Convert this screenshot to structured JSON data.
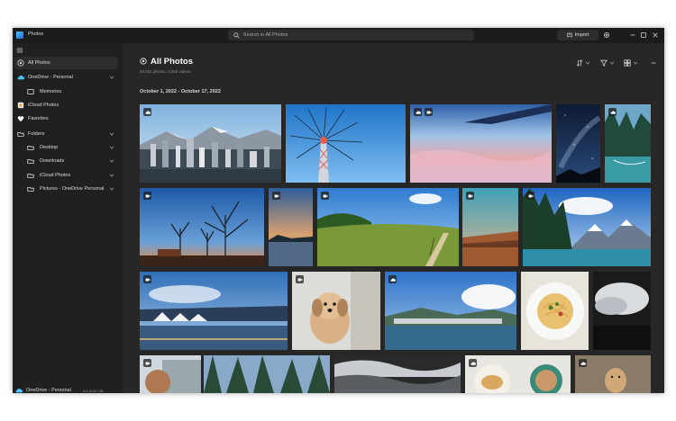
{
  "app": {
    "title": "Photos",
    "accent": "#4cc2ff"
  },
  "titlebar": {
    "search_placeholder": "Search in All Photos",
    "import_label": "Import"
  },
  "sidebar": {
    "items": [
      {
        "label": "All Photos",
        "icon": "photos-icon",
        "active": true
      },
      {
        "label": "OneDrive - Personal",
        "icon": "cloud-icon",
        "expandable": true
      },
      {
        "label": "Memories",
        "icon": "memories-icon"
      },
      {
        "label": "iCloud Photos",
        "icon": "icloud-icon"
      },
      {
        "label": "Favorites",
        "icon": "heart-icon"
      },
      {
        "label": "Folders",
        "icon": "folder-icon",
        "expandable": true
      },
      {
        "label": "Desktop",
        "icon": "folder-icon",
        "expandable": true
      },
      {
        "label": "Downloads",
        "icon": "folder-icon",
        "expandable": true
      },
      {
        "label": "iCloud Photos",
        "icon": "folder-icon",
        "expandable": true
      },
      {
        "label": "Pictures - OneDrive Personal",
        "icon": "folder-icon",
        "expandable": true
      }
    ],
    "bottom": {
      "label": "OneDrive - Personal",
      "storage": "0.8 of 50 GB",
      "storage_fraction": 0.18
    }
  },
  "main": {
    "title": "All Photos",
    "subtitle": "40,631 photos, 3,055 videos",
    "date_range": "October 1, 2022 - October 17, 2022"
  },
  "photos": [
    {
      "name": "vancouver-city",
      "badge": "cloud-icon"
    },
    {
      "name": "wave-swinger-ride"
    },
    {
      "name": "airplane-window-view",
      "badge": "video-icon"
    },
    {
      "name": "night-sky"
    },
    {
      "name": "lake-forest",
      "badge": "cloud-icon"
    },
    {
      "name": "winter-sunset-trees",
      "badge": "video-icon"
    },
    {
      "name": "lakeside-evening",
      "badge": "video-icon"
    },
    {
      "name": "green-meadow",
      "badge": "video-icon"
    },
    {
      "name": "red-cliff-coast",
      "badge": "video-icon"
    },
    {
      "name": "mountain-lake",
      "badge": "video-icon"
    },
    {
      "name": "harbor-skyline",
      "badge": "video-icon"
    },
    {
      "name": "puppy",
      "badge": "video-icon"
    },
    {
      "name": "lake-town",
      "badge": "cloud-icon"
    },
    {
      "name": "pasta-plate"
    },
    {
      "name": "storm-clouds"
    },
    {
      "name": "dog-bottom-left",
      "badge": "video-icon"
    },
    {
      "name": "forest-bottom"
    },
    {
      "name": "beach-waves"
    },
    {
      "name": "breakfast-coffee",
      "badge": "cloud-icon"
    },
    {
      "name": "dog-bottom-right",
      "badge": "cloud-icon"
    }
  ]
}
